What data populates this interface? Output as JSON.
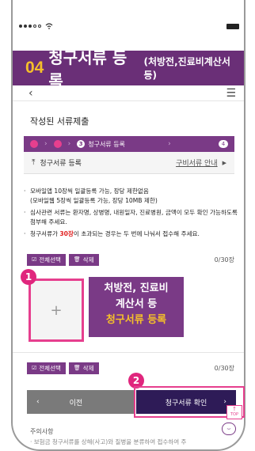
{
  "statusbar": {
    "wifi_icon": "wifi-icon",
    "battery_icon": "battery-icon"
  },
  "hero": {
    "number": "04",
    "title": "청구서류 등록",
    "subtitle": "(처방전,진료비계산서 등)"
  },
  "appbar": {
    "back_icon": "chevron-left-icon",
    "menu_icon": "hamburger-menu-icon"
  },
  "section_title": "작성된 서류제출",
  "stepper": {
    "current_step": "3",
    "current_label": "청구서류 등록",
    "total_steps": "4"
  },
  "upload": {
    "label": "청구서류 등록",
    "guide_link": "구비서류 안내"
  },
  "notes": {
    "line1a": "모바일앱 10장씩 일괄등록 가능, 장당 제한없음",
    "line1b": "(모바일웹 5장씩 일괄등록 가능, 장당 10MB 제한)",
    "line2": "심사관련 서류는 환자명, 상병명, 내원일자, 진료병원, 금액이 모두 확인 가능하도록 첨부해 주세요.",
    "line3_pre": "청구서류가 ",
    "line3_red": "30장",
    "line3_post": "이 초과되는 경우는 두 번에 나눠서 접수해 주세요."
  },
  "toolbar": {
    "select_all": "전체선택",
    "delete": "삭제",
    "count": "0/30장"
  },
  "add_box": {
    "plus": "+"
  },
  "badges": {
    "one": "1",
    "two": "2"
  },
  "callout": {
    "line1": "처방전, 진료비",
    "line2": "계산서 등",
    "line3": "청구서류 등록"
  },
  "footer_buttons": {
    "prev": "이전",
    "next": "청구서류 확인"
  },
  "top_button": {
    "label": "TOP"
  },
  "notice": {
    "title": "주의사항",
    "body": "· 보험금 청구서류를 상해(사고)와 질병을 분류하여 접수하여 주"
  },
  "colors": {
    "purple": "#7a3a86",
    "hero": "#6a2f77",
    "pink": "#e63f8e",
    "yellow": "#f5c02a",
    "navy": "#2e1b57"
  }
}
